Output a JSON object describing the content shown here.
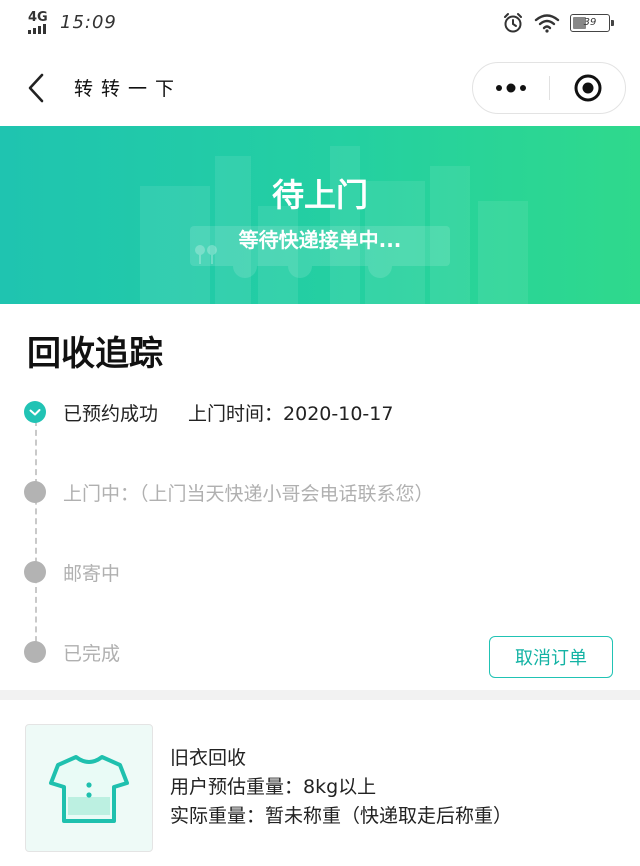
{
  "status_bar": {
    "network": "4G",
    "time": "15:09",
    "battery": "39",
    "battery_level": 0.39,
    "icons": [
      "signal-icon",
      "alarm-icon",
      "wifi-icon",
      "battery-icon"
    ]
  },
  "nav": {
    "title": "转转一下",
    "icons": [
      "back-icon",
      "more-dots-icon",
      "target-close-icon"
    ]
  },
  "banner": {
    "title": "待上门",
    "subtitle": "等待快递接单中..."
  },
  "tracking": {
    "title": "回收追踪",
    "steps": [
      {
        "label": "已预约成功",
        "time": "上门时间：2020-10-17",
        "done": true
      },
      {
        "label": "上门中：（上门当天快递小哥会电话联系您）",
        "done": false
      },
      {
        "label": "邮寄中",
        "done": false
      },
      {
        "label": "已完成",
        "done": false
      }
    ],
    "cancel_label": "取消订单"
  },
  "item": {
    "name": "旧衣回收",
    "estimated_weight": "用户预估重量：8kg以上",
    "actual_weight": "实际重量：暂未称重（快递取走后称重）",
    "icon": "tshirt-icon"
  },
  "colors": {
    "accent": "#21c3b4",
    "banner_start": "#1fc4b0",
    "banner_end": "#2fd98c",
    "inactive": "#b3b3b3"
  }
}
